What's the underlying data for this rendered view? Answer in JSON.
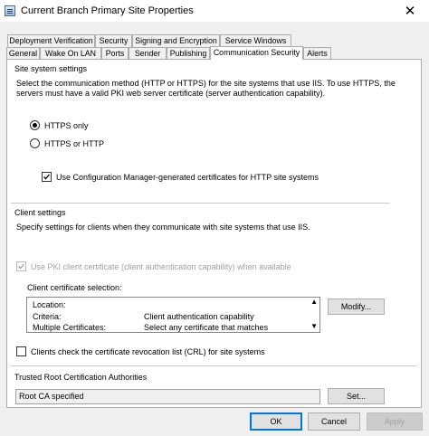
{
  "window": {
    "title": "Current Branch Primary Site Properties",
    "close_glyph": "✕"
  },
  "tabs_row1": [
    {
      "label": "Deployment Verification"
    },
    {
      "label": "Security"
    },
    {
      "label": "Signing and Encryption"
    },
    {
      "label": "Service Windows"
    }
  ],
  "tabs_row2": [
    {
      "label": "General"
    },
    {
      "label": "Wake On LAN"
    },
    {
      "label": "Ports"
    },
    {
      "label": "Sender"
    },
    {
      "label": "Publishing"
    },
    {
      "label": "Communication Security",
      "active": true
    },
    {
      "label": "Alerts"
    }
  ],
  "site_system": {
    "heading": "Site system settings",
    "description": "Select the communication method (HTTP or HTTPS) for the site systems that use IIS. To use HTTPS, the servers must have a valid PKI web server certificate (server authentication capability).",
    "radio_https_only": {
      "label": "HTTPS only",
      "checked": true
    },
    "radio_https_or_http": {
      "label": "HTTPS or HTTP",
      "checked": false
    },
    "checkbox_cm_certs": {
      "label": "Use Configuration Manager-generated certificates for HTTP site systems",
      "checked": true
    }
  },
  "client": {
    "heading": "Client settings",
    "description": "Specify settings for clients when they communicate with site systems that use IIS.",
    "checkbox_pki": {
      "label": "Use PKI client certificate (client authentication capability) when available",
      "checked": true,
      "disabled": true
    },
    "cert_selection_label": "Client certificate selection:",
    "cert_rows": [
      {
        "key": "Location:",
        "value": ""
      },
      {
        "key": "Criteria:",
        "value": "Client authentication capability"
      },
      {
        "key": "Multiple Certificates:",
        "value": "Select any certificate that matches"
      }
    ],
    "modify_button": "Modify...",
    "checkbox_crl": {
      "label": "Clients check the certificate revocation list (CRL) for site systems",
      "checked": false
    }
  },
  "trusted_root": {
    "heading": "Trusted Root Certification Authorities",
    "value": "Root CA specified",
    "set_button": "Set..."
  },
  "footer": {
    "ok": "OK",
    "cancel": "Cancel",
    "apply": "Apply"
  }
}
